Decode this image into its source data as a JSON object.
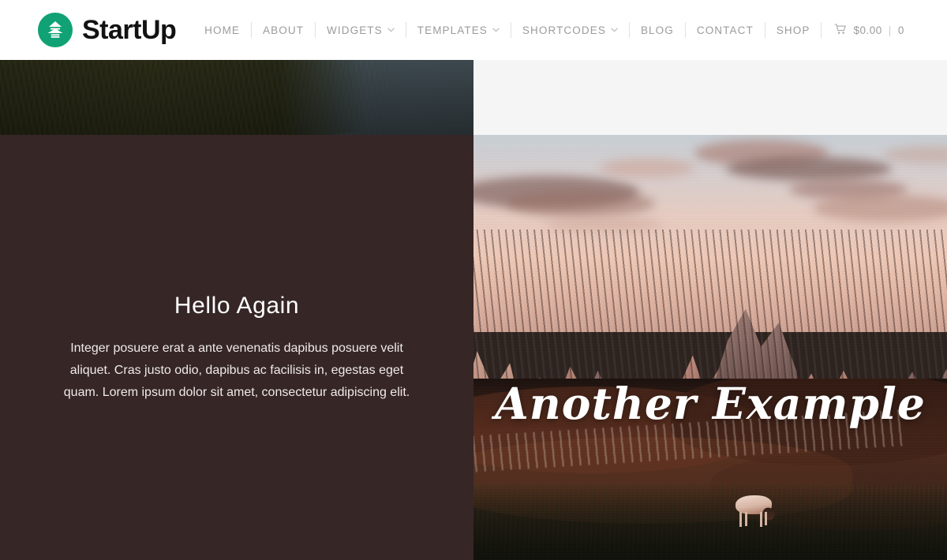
{
  "header": {
    "logo": {
      "icon": "stacked-hive-logo-icon",
      "name": "StartUp",
      "circle_color": "#10a274"
    },
    "nav": [
      {
        "label": "HOME",
        "has_dropdown": false
      },
      {
        "label": "ABOUT",
        "has_dropdown": false
      },
      {
        "label": "WIDGETS",
        "has_dropdown": true
      },
      {
        "label": "TEMPLATES",
        "has_dropdown": true
      },
      {
        "label": "SHORTCODES",
        "has_dropdown": true
      },
      {
        "label": "BLOG",
        "has_dropdown": false
      },
      {
        "label": "CONTACT",
        "has_dropdown": false
      },
      {
        "label": "SHOP",
        "has_dropdown": false
      }
    ],
    "cart": {
      "icon": "shopping-cart-icon",
      "amount": "$0.00",
      "divider": "|",
      "count": "0"
    },
    "nav_color": "#9b9b9b",
    "background": "#ffffff"
  },
  "hero": {
    "background_color": "#f5f5f5",
    "previous_section_photo": {
      "alt": "dark grassy riverbank at dusk",
      "name": "grass-riverbank-photo"
    },
    "text_panel": {
      "background": "#362626",
      "title": "Hello Again",
      "body": "Integer posuere erat a ante venenatis dapibus posuere velit aliquet. Cras justo odio, dapibus ac facilisis in, egestas eget quam. Lorem ipsum dolor sit amet, consectetur adipiscing elit."
    },
    "photo_panel": {
      "alt": "sunset over jagged dolomite mountains with a grazing cow in the meadow",
      "name": "dolomites-sunset-photo",
      "caption": "Another Example",
      "caption_color": "#ffffff"
    }
  }
}
